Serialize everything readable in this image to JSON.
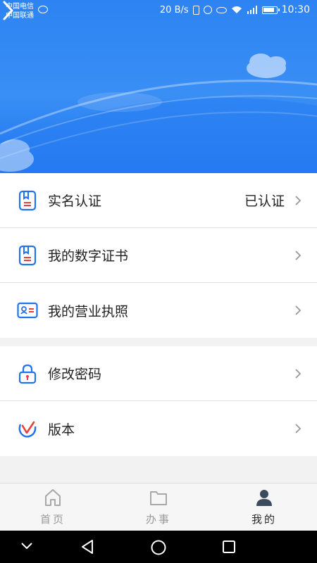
{
  "status_bar": {
    "carrier_1": "中国电信",
    "carrier_2": "中国联通",
    "speed": "20 B/s",
    "time": "10:30"
  },
  "menu": {
    "real_name": {
      "label": "实名认证",
      "status": "已认证",
      "icon": "id-card-icon"
    },
    "certificate": {
      "label": "我的数字证书",
      "icon": "certificate-icon"
    },
    "license": {
      "label": "我的营业执照",
      "icon": "business-license-icon"
    },
    "password": {
      "label": "修改密码",
      "icon": "lock-icon"
    },
    "version": {
      "label": "版本",
      "icon": "version-logo-icon"
    }
  },
  "tabs": [
    {
      "label": "首页",
      "icon": "home-icon",
      "active": false
    },
    {
      "label": "办事",
      "icon": "folder-icon",
      "active": false
    },
    {
      "label": "我的",
      "icon": "person-icon",
      "active": true
    }
  ],
  "colors": {
    "accent": "#1f74ee",
    "icon_red": "#e8413b",
    "banner_top": "#2d83f2"
  }
}
